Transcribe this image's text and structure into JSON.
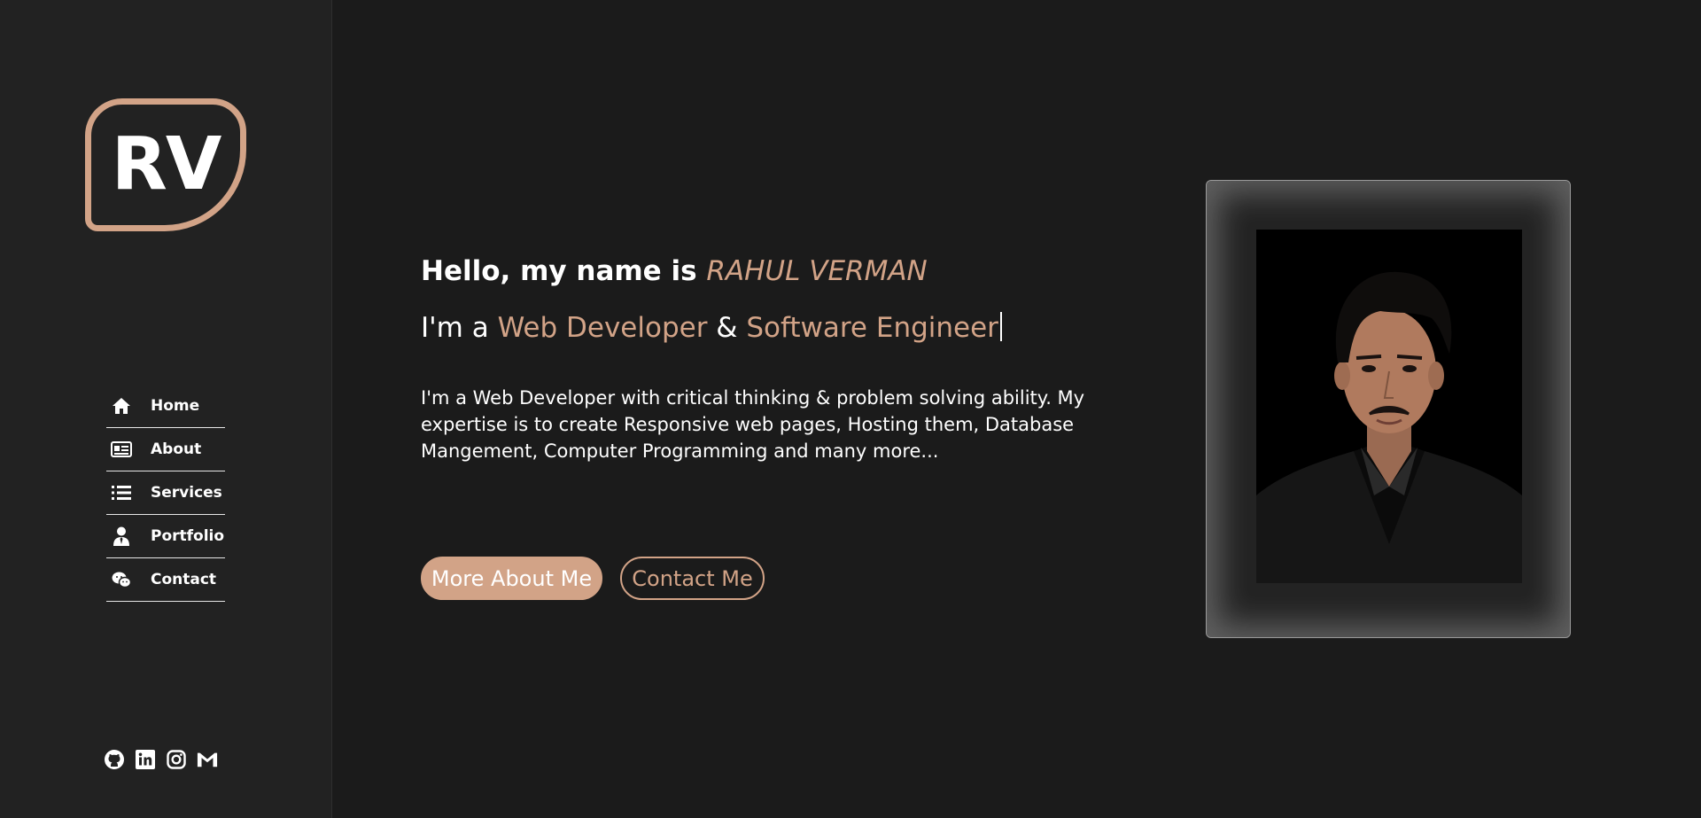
{
  "logo": {
    "text": "RV"
  },
  "nav": {
    "items": [
      {
        "label": "Home",
        "icon": "home-icon"
      },
      {
        "label": "About",
        "icon": "id-card-icon"
      },
      {
        "label": "Services",
        "icon": "list-icon"
      },
      {
        "label": "Portfolio",
        "icon": "user-tie-icon"
      },
      {
        "label": "Contact",
        "icon": "chat-icon"
      }
    ]
  },
  "social": [
    "github-icon",
    "linkedin-icon",
    "instagram-icon",
    "gmail-icon"
  ],
  "hero": {
    "greeting_prefix": "Hello, my name is ",
    "name": "RAHUL VERMAN",
    "role_prefix": "I'm a ",
    "role_one": "Web Developer",
    "role_joiner": " & ",
    "role_two": "Software Engineer",
    "description": "I'm a Web Developer with critical thinking & problem solving ability. My expertise is to create Responsive web pages, Hosting them, Database Mangement, Computer Programming and many more...",
    "primary_button": "More About Me",
    "secondary_button": "Contact Me"
  },
  "colors": {
    "accent": "#d2a387",
    "background": "#1b1b1b",
    "sidebar": "#222222"
  }
}
